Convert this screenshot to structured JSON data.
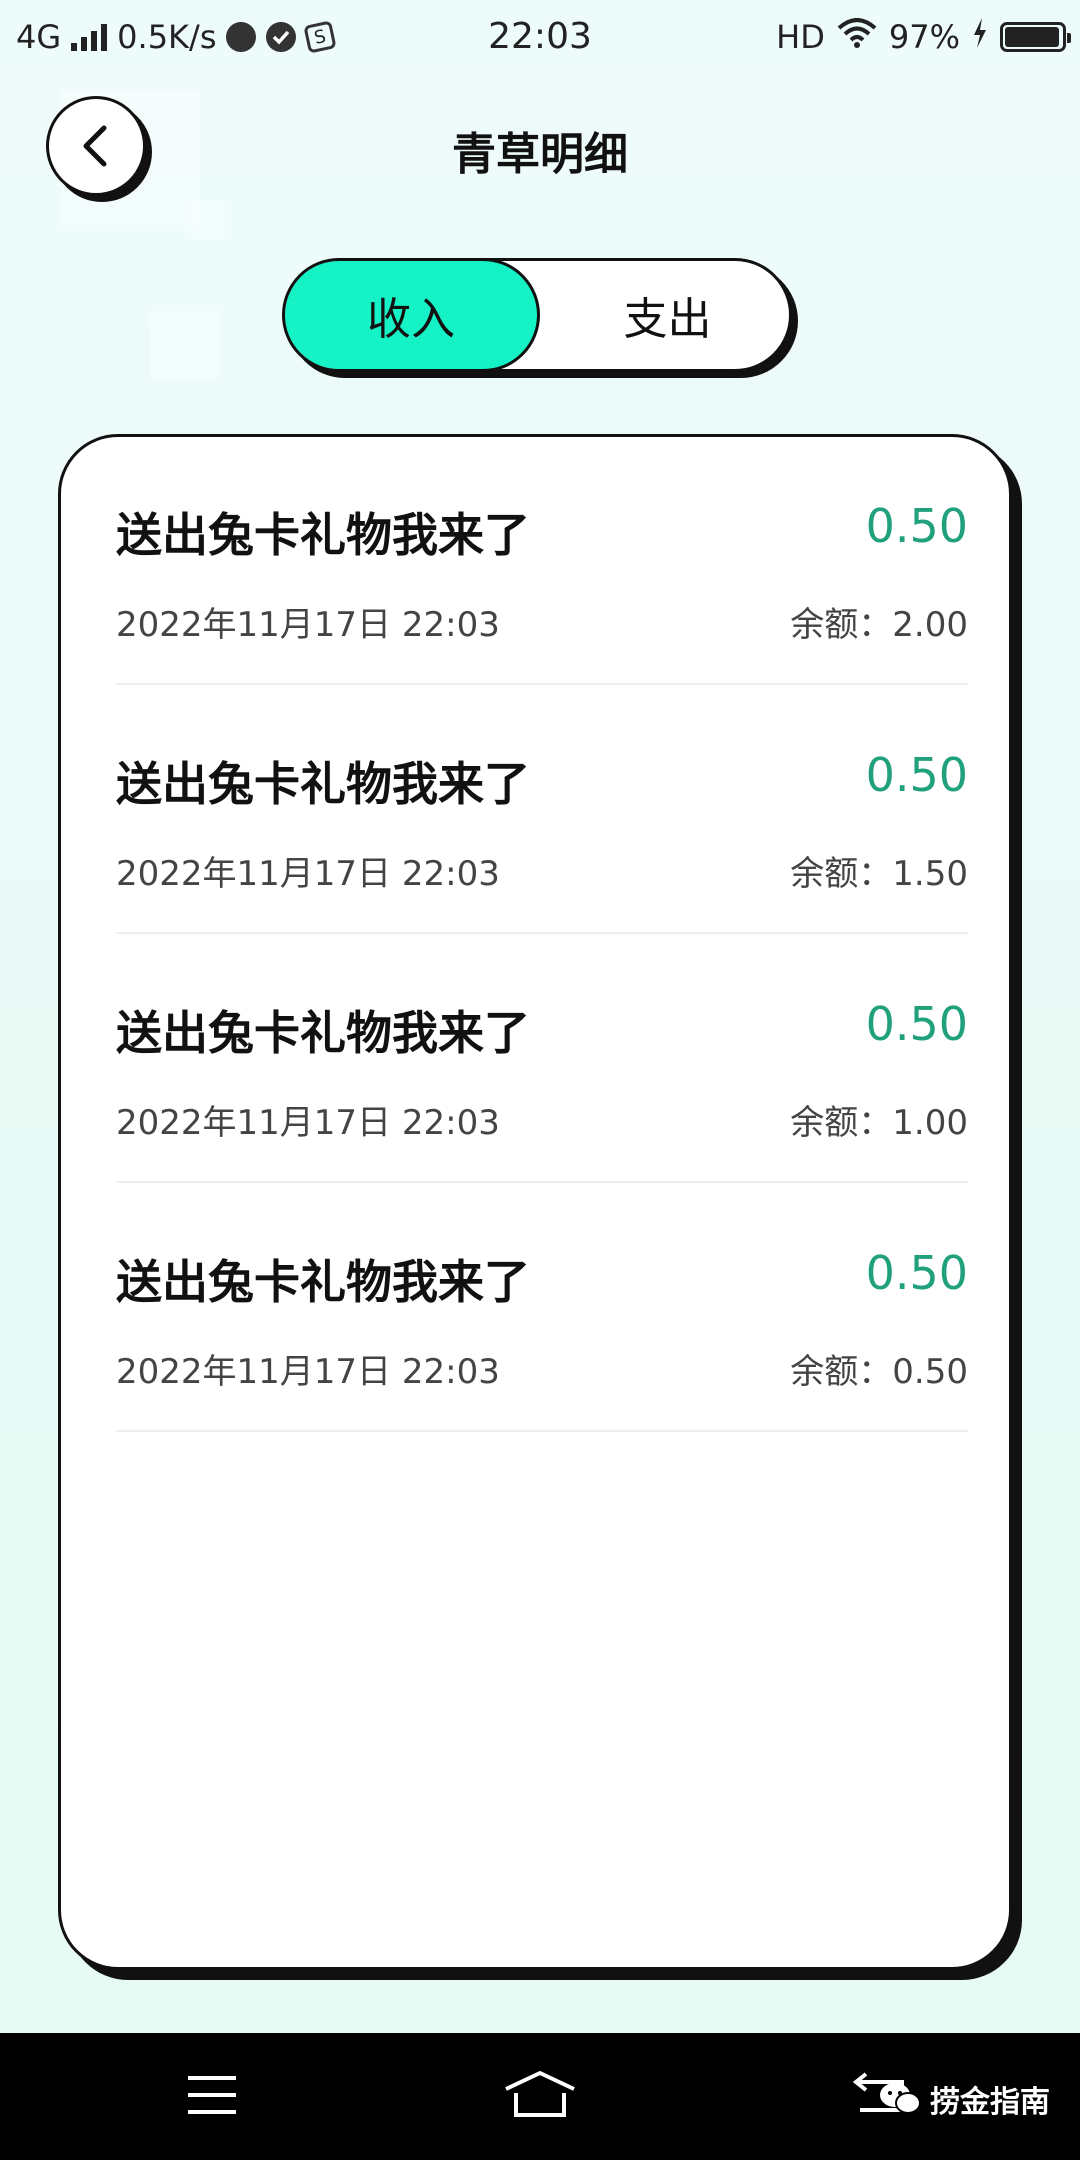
{
  "status_bar": {
    "network": "4G",
    "speed": "0.5K/s",
    "time": "22:03",
    "hd": "HD",
    "battery": "97%",
    "battery_level": 0.97
  },
  "header": {
    "title": "青草明细"
  },
  "tabs": [
    {
      "label": "收入",
      "selected": true
    },
    {
      "label": "支出",
      "selected": false
    }
  ],
  "records": [
    {
      "title": "送出兔卡礼物我来了",
      "amount": "0.50",
      "time": "2022年11月17日 22:03",
      "balance": "余额：2.00"
    },
    {
      "title": "送出兔卡礼物我来了",
      "amount": "0.50",
      "time": "2022年11月17日 22:03",
      "balance": "余额：1.50"
    },
    {
      "title": "送出兔卡礼物我来了",
      "amount": "0.50",
      "time": "2022年11月17日 22:03",
      "balance": "余额：1.00"
    },
    {
      "title": "送出兔卡礼物我来了",
      "amount": "0.50",
      "time": "2022年11月17日 22:03",
      "balance": "余额：0.50"
    }
  ],
  "watermark": {
    "text": "捞金指南"
  },
  "colors": {
    "accent": "#15f2c6",
    "amount": "#21a07c"
  },
  "icons": {
    "back": "chevron-left-icon",
    "menu": "menu-icon",
    "home": "home-icon",
    "back_nav": "back-arrow-icon",
    "wechat": "wechat-icon"
  }
}
